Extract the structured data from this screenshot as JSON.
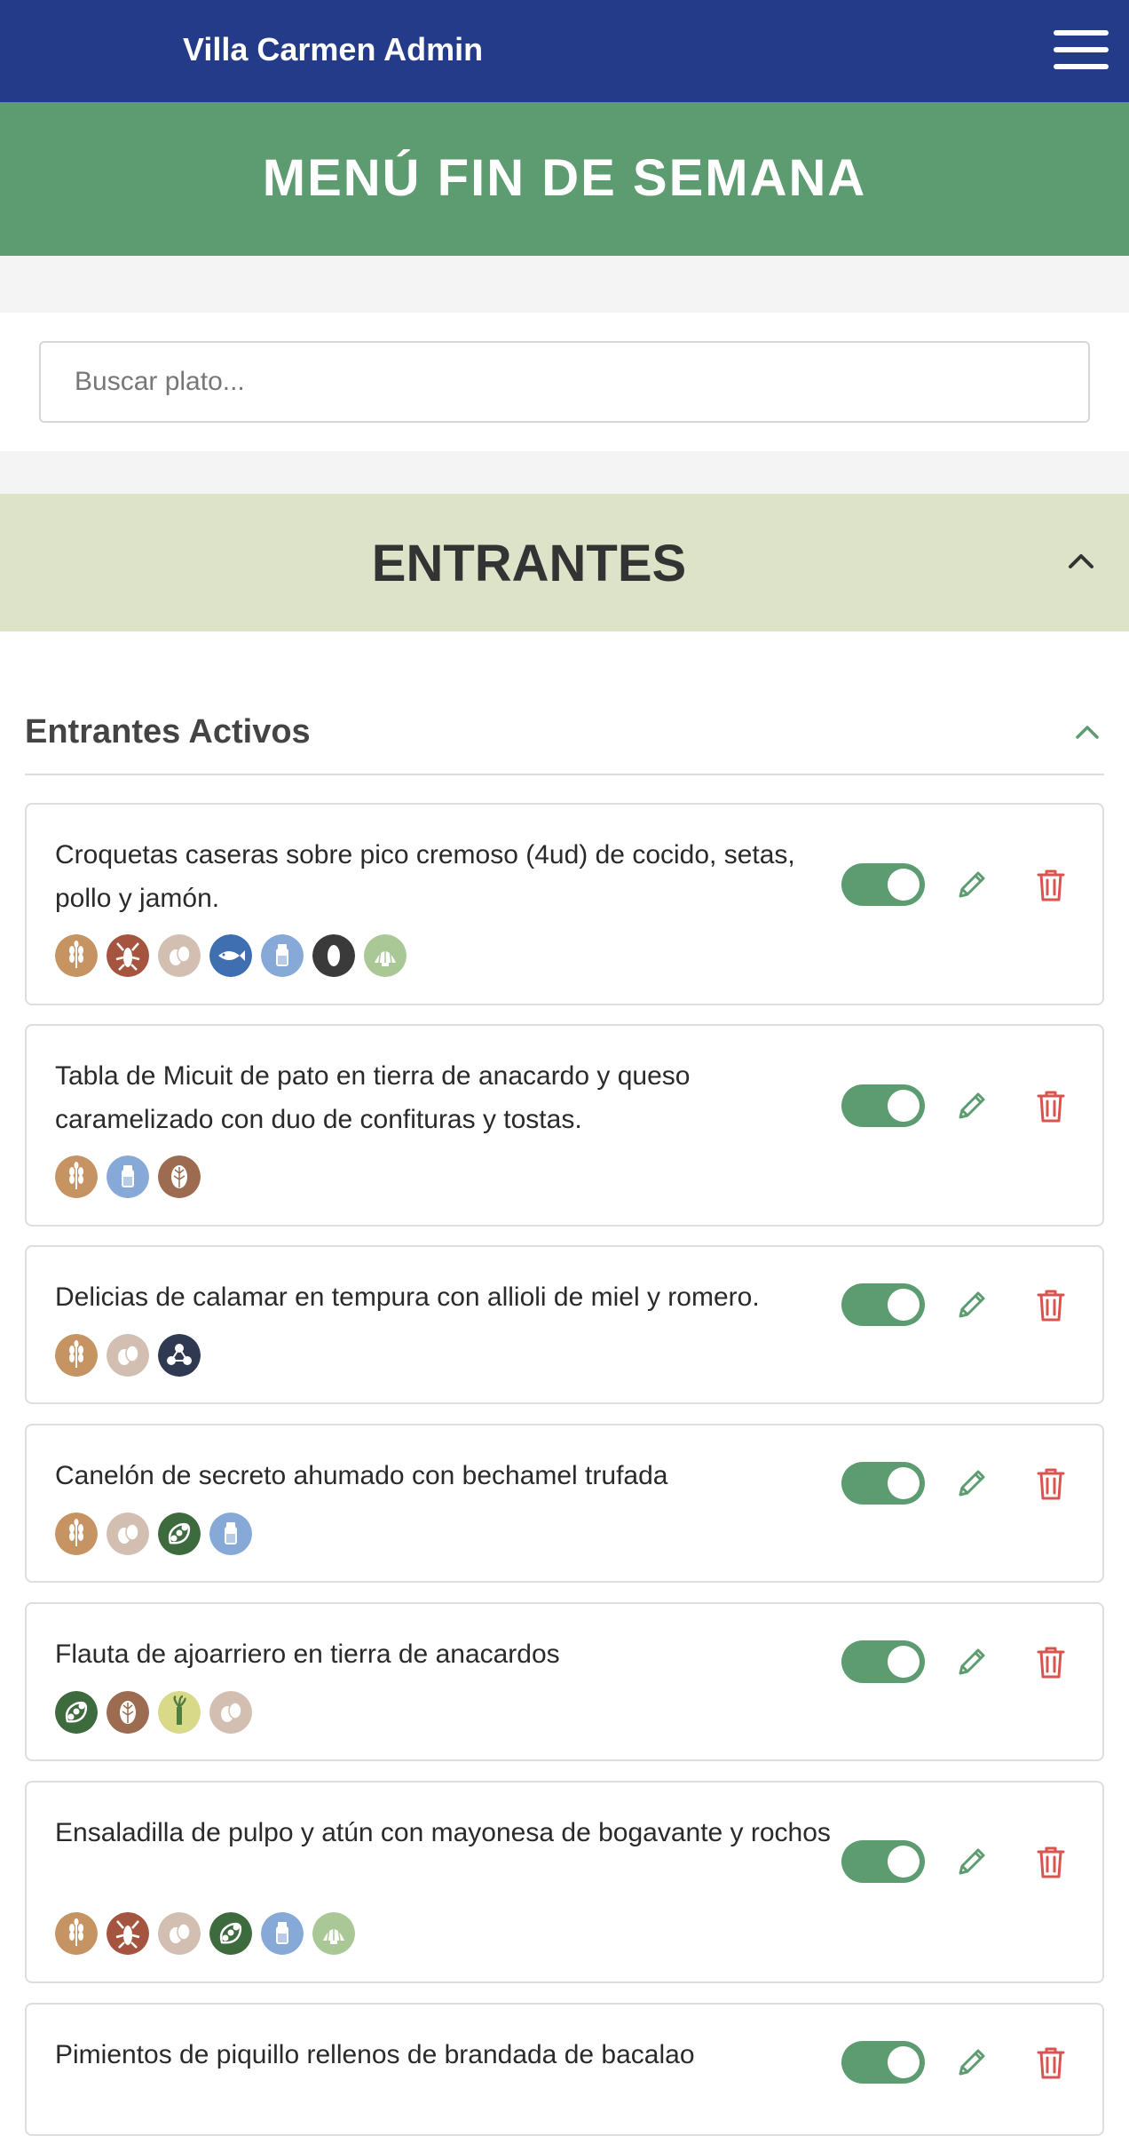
{
  "app": {
    "title": "Villa Carmen Admin"
  },
  "banner": {
    "title": "MENÚ FIN DE SEMANA"
  },
  "search": {
    "placeholder": "Buscar plato..."
  },
  "section": {
    "title": "ENTRANTES"
  },
  "subsection": {
    "title": "Entrantes Activos"
  },
  "colors": {
    "navbar": "#233b88",
    "banner": "#5d9b70",
    "section_bg": "#dce3c9",
    "toggle_on": "#5d9b70",
    "edit": "#5d9b70",
    "delete": "#d9534f"
  },
  "dishes": [
    {
      "name": "Croquetas caseras sobre pico cremoso (4ud) de cocido, setas, pollo y jamón.",
      "active": true,
      "allergens": [
        "gluten-icon",
        "crustaceans-icon",
        "eggs-icon",
        "fish-icon",
        "milk-icon",
        "sesame-icon",
        "molluscs-icon"
      ]
    },
    {
      "name": "Tabla de Micuit de pato en tierra de anacardo y queso caramelizado con duo de confituras y tostas.",
      "active": true,
      "allergens": [
        "gluten-icon",
        "milk-icon",
        "nuts-icon"
      ]
    },
    {
      "name": "Delicias de calamar en tempura con allioli de miel y romero.",
      "active": true,
      "allergens": [
        "gluten-icon",
        "eggs-icon",
        "sulphites-icon"
      ]
    },
    {
      "name": "Canelón de secreto ahumado con bechamel trufada",
      "active": true,
      "allergens": [
        "gluten-icon",
        "eggs-icon",
        "soy-icon",
        "milk-icon"
      ]
    },
    {
      "name": "Flauta de ajoarriero en tierra de anacardos",
      "active": true,
      "allergens": [
        "soy-icon",
        "nuts-icon",
        "celery-icon",
        "eggs-icon"
      ]
    },
    {
      "name": "Ensaladilla de pulpo y atún con mayonesa de bogavante y rochos",
      "active": true,
      "allergens": [
        "gluten-icon",
        "crustaceans-icon",
        "eggs-icon",
        "soy-icon",
        "milk-icon",
        "molluscs-icon"
      ]
    },
    {
      "name": "Pimientos de piquillo rellenos de brandada de bacalao",
      "active": true,
      "allergens": []
    }
  ]
}
